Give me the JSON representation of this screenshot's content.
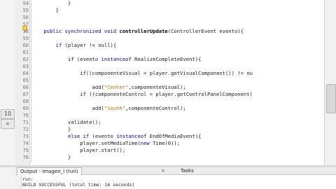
{
  "left_panel": {
    "tabs": [
      "10",
      "«"
    ]
  },
  "editor": {
    "line_numbers": [
      "54",
      "55",
      "56",
      "57",
      "58",
      "59",
      "60",
      "61",
      "62",
      "63",
      "64",
      "65",
      "66",
      "67",
      "68",
      "69",
      "70",
      "71",
      "72",
      "73",
      "74",
      "75",
      "76"
    ],
    "lines": [
      "            }",
      "        }",
      "",
      "",
      "    public synchronized void controllerUpdate(ControllerEvent evento){",
      "",
      "        if (player != null){",
      "",
      "            if (evento instanceof RealizeCompleteEvent){",
      "",
      "                if((componenteVisual = player.getVisualComponent()) != nu",
      "",
      "                    add(\"Center\",componenteVisual);",
      "                if ((componenteControl = player.getControlPanelComponent(",
      "",
      "                    add(\"South\",componenteControl);",
      "",
      "            validate();",
      "            }",
      "            else if (evento instanceof EndOfMediaEvent){",
      "                player.setMediaTime(new Time(0));",
      "                player.start();",
      "            }"
    ]
  },
  "output": {
    "tab_label": "Output - Imagen_I (run)",
    "close_glyph": "×",
    "tasks_label": "Tasks",
    "lines": [
      "run:",
      "BUILD SUCCESSFUL (total time: 16 seconds)"
    ]
  }
}
